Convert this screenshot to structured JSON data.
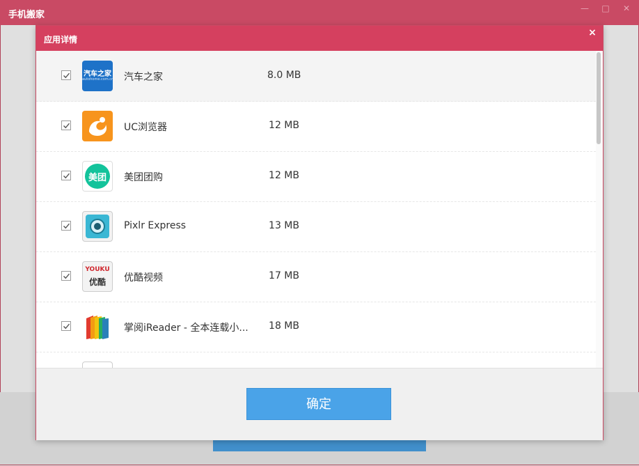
{
  "window": {
    "title": "手机搬家",
    "controls": {
      "minimize": "—",
      "maximize": "□",
      "close": "✕"
    }
  },
  "dialog": {
    "title": "应用详情",
    "close_symbol": "×",
    "confirm_label": "确定"
  },
  "apps": [
    {
      "name": "汽车之家",
      "size": "8.0 MB",
      "checked": true,
      "icon": "autohome-icon",
      "icon_text": "汽车之家",
      "icon_subtext": "autohome.com.cn"
    },
    {
      "name": "UC浏览器",
      "size": "12 MB",
      "checked": true,
      "icon": "uc-browser-icon"
    },
    {
      "name": "美团团购",
      "size": "12 MB",
      "checked": true,
      "icon": "meituan-icon",
      "icon_text": "美团"
    },
    {
      "name": "Pixlr Express",
      "size": "13 MB",
      "checked": true,
      "icon": "pixlr-icon"
    },
    {
      "name": "优酷视频",
      "size": "17 MB",
      "checked": true,
      "icon": "youku-icon",
      "icon_text": "YOUKU",
      "icon_subtext": "优酷"
    },
    {
      "name": "掌阅iReader - 全本连载小...",
      "size": "18 MB",
      "checked": true,
      "icon": "ireader-icon"
    }
  ],
  "colors": {
    "title_bar": "#c94a64",
    "dialog_header": "#d5405f",
    "button_blue": "#4aa3e8"
  }
}
